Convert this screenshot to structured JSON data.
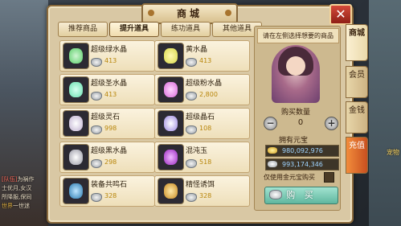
{
  "window": {
    "title": "商城",
    "close_label": "✕"
  },
  "category_tabs": [
    {
      "label": "推荐商品",
      "active": false
    },
    {
      "label": "提升道具",
      "active": true
    },
    {
      "label": "练功道具",
      "active": false
    },
    {
      "label": "其他道具",
      "active": false
    }
  ],
  "items": [
    {
      "name": "超级绿水晶",
      "price": "413",
      "gem_color": "#5ccf6a"
    },
    {
      "name": "黄水晶",
      "price": "413",
      "gem_color": "#d9d94a"
    },
    {
      "name": "超级圣水晶",
      "price": "413",
      "gem_color": "#6ae0b0"
    },
    {
      "name": "超级粉水晶",
      "price": "2,800",
      "gem_color": "#d96ad9"
    },
    {
      "name": "超级灵石",
      "price": "998",
      "gem_color": "#e8e0f0"
    },
    {
      "name": "超级晶石",
      "price": "108",
      "gem_color": "#c9b6ff"
    },
    {
      "name": "超级黑水晶",
      "price": "298",
      "gem_color": "#f0f0f0"
    },
    {
      "name": "混沌玉",
      "price": "518",
      "gem_color": "#c04ae0"
    },
    {
      "name": "装备共鸣石",
      "price": "328",
      "gem_color": "#4aa0d9"
    },
    {
      "name": "精怪诱饵",
      "price": "328",
      "gem_color": "#e0a83a"
    }
  ],
  "detail": {
    "hint": "请在左侧选择想要的商品",
    "quantity_label": "购买数量",
    "quantity_value": "0",
    "minus_label": "−",
    "plus_label": "+",
    "own_label": "拥有元宝",
    "gold_balance": "980,092,976",
    "silver_balance": "993,174,346",
    "only_gold_label": "仅使用金元宝购买",
    "buy_label": "购 买"
  },
  "side_tabs": [
    {
      "label": "商城",
      "active": true
    },
    {
      "label": "会员",
      "active": false
    },
    {
      "label": "金钱",
      "active": false
    },
    {
      "label": "充值",
      "active": false,
      "recharge": true
    }
  ],
  "chat": [
    {
      "tag": "[队伍]",
      "text": "为祸作"
    },
    {
      "tag": "",
      "text": "士优月,女汉"
    },
    {
      "tag": "",
      "text": "所降服,保同"
    },
    {
      "tag": "世界",
      "text": "一世迷"
    }
  ],
  "side_note": "宠物"
}
